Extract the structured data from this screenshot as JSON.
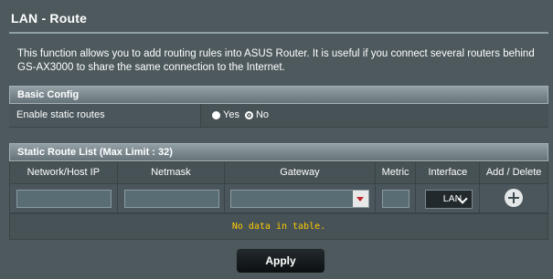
{
  "page": {
    "title": "LAN - Route",
    "description": "This function allows you to add routing rules into ASUS Router. It is useful if you connect several routers behind GS-AX3000 to share the same connection to the Internet."
  },
  "basic_config": {
    "header": "Basic Config",
    "enable_static_routes": {
      "label": "Enable static routes",
      "options": [
        "Yes",
        "No"
      ],
      "selected": "No"
    }
  },
  "route_list": {
    "header": "Static Route List (Max Limit : 32)",
    "columns": [
      "Network/Host IP",
      "Netmask",
      "Gateway",
      "Metric",
      "Interface",
      "Add / Delete"
    ],
    "inputs": {
      "network_ip": "",
      "netmask": "",
      "gateway": "",
      "metric": "",
      "interface": "LAN"
    },
    "empty_message": "No data in table."
  },
  "actions": {
    "apply_label": "Apply"
  },
  "icons": {
    "add": "plus-circle-icon",
    "gateway_dropdown": "triangle-down-icon",
    "interface_dropdown": "chevron-down-icon"
  },
  "colors": {
    "background": "#4d595d",
    "empty_message": "#ffcc00",
    "dropdown_arrow": "#c0262b"
  }
}
